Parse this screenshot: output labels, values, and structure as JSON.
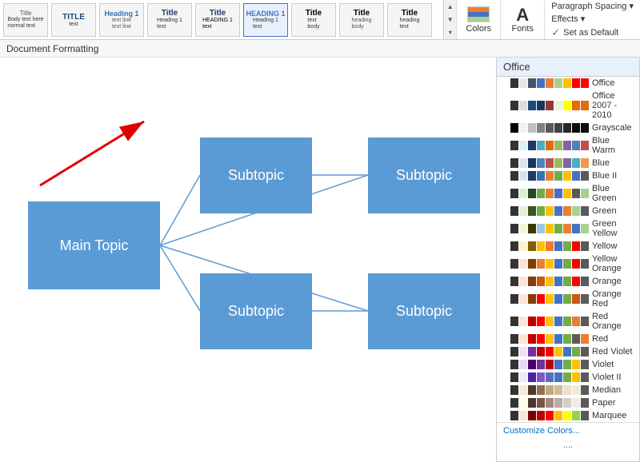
{
  "ribbon": {
    "styles": [
      {
        "label": "Normal",
        "lines": [
          "body",
          "body"
        ]
      },
      {
        "label": "TITLE",
        "lines": [
          "title"
        ]
      },
      {
        "label": "Text",
        "lines": [
          "text"
        ]
      },
      {
        "label": "Title",
        "lines": [
          "Title"
        ]
      },
      {
        "label": "Title",
        "lines": [
          "Title"
        ]
      },
      {
        "label": "HEADING 1",
        "lines": [
          "Heading 1"
        ]
      },
      {
        "label": "Title",
        "lines": [
          "Title"
        ]
      },
      {
        "label": "Title",
        "lines": [
          "Title"
        ]
      },
      {
        "label": "Title",
        "lines": [
          "Title"
        ]
      }
    ],
    "colors_label": "Colors",
    "fonts_label": "Fonts",
    "paragraph_spacing_label": "Paragraph Spacing ▾",
    "effects_label": "Effects ▾",
    "set_as_default_label": "Set as Default"
  },
  "doc_format_bar": {
    "label": "Document Formatting"
  },
  "mindmap": {
    "main_topic": "Main Topic",
    "subtopic1": "Subtopic",
    "subtopic2": "Subtopic",
    "subtopic3": "Subtopic",
    "subtopic4": "Subtopic"
  },
  "dropdown": {
    "header": "Office",
    "items": [
      {
        "label": "Office",
        "swatches": [
          "#fff",
          "#333",
          "#e7e6e6",
          "#44546a",
          "#4472c4",
          "#ed7d31",
          "#a9d18e",
          "#ffc000",
          "#ff0000",
          "#ff0000"
        ]
      },
      {
        "label": "Office 2007 - 2010",
        "swatches": [
          "#fff",
          "#333",
          "#ddd",
          "#1f497d",
          "#17375e",
          "#953734",
          "#ebf1dd",
          "#ffff00",
          "#e26b0a",
          "#e26b0a"
        ]
      },
      {
        "label": "Grayscale",
        "swatches": [
          "#fff",
          "#000",
          "#f2f2f2",
          "#bfbfbf",
          "#808080",
          "#595959",
          "#404040",
          "#262626",
          "#0d0d0d",
          "#0d0d0d"
        ]
      },
      {
        "label": "Blue Warm",
        "swatches": [
          "#fff",
          "#333",
          "#daeef3",
          "#1f3864",
          "#4bacc6",
          "#e36c09",
          "#9bbb59",
          "#8064a2",
          "#4f81bd",
          "#c0504d"
        ]
      },
      {
        "label": "Blue",
        "swatches": [
          "#fff",
          "#333",
          "#dce6f1",
          "#17375e",
          "#4f81bd",
          "#c0504d",
          "#9bbb59",
          "#8064a2",
          "#4bacc6",
          "#f79646"
        ]
      },
      {
        "label": "Blue II",
        "swatches": [
          "#fff",
          "#333",
          "#d9e2f3",
          "#1f3864",
          "#2f75b6",
          "#ed7d31",
          "#70ad47",
          "#ffc000",
          "#4472c4",
          "#5a5a5a"
        ]
      },
      {
        "label": "Blue Green",
        "swatches": [
          "#fff",
          "#333",
          "#d9f0d3",
          "#244a25",
          "#70ad47",
          "#ed7d31",
          "#4472c4",
          "#ffc000",
          "#5a5a5a",
          "#a9d18e"
        ]
      },
      {
        "label": "Green",
        "swatches": [
          "#fff",
          "#333",
          "#e2efda",
          "#375623",
          "#70ad47",
          "#ffc000",
          "#4472c4",
          "#ed7d31",
          "#a9d18e",
          "#5a5a5a"
        ]
      },
      {
        "label": "Green Yellow",
        "swatches": [
          "#fff",
          "#333",
          "#f2f7da",
          "#3a3a00",
          "#9dc3e6",
          "#ffc000",
          "#70ad47",
          "#ed7d31",
          "#4472c4",
          "#a9d18e"
        ]
      },
      {
        "label": "Yellow",
        "swatches": [
          "#fff",
          "#333",
          "#fff2cc",
          "#7f6000",
          "#ffc000",
          "#ed7d31",
          "#4472c4",
          "#70ad47",
          "#ff0000",
          "#5a5a5a"
        ]
      },
      {
        "label": "Yellow Orange",
        "swatches": [
          "#fff",
          "#333",
          "#fce4d6",
          "#833c00",
          "#ed7d31",
          "#ffc000",
          "#4472c4",
          "#70ad47",
          "#ff0000",
          "#5a5a5a"
        ]
      },
      {
        "label": "Orange",
        "swatches": [
          "#fff",
          "#333",
          "#fce4d6",
          "#843c0c",
          "#c55a11",
          "#ffc000",
          "#4472c4",
          "#70ad47",
          "#ff0000",
          "#5a5a5a"
        ]
      },
      {
        "label": "Orange Red",
        "swatches": [
          "#fff",
          "#333",
          "#fce4d6",
          "#843c0c",
          "#ff0000",
          "#ffc000",
          "#4472c4",
          "#70ad47",
          "#c55a11",
          "#5a5a5a"
        ]
      },
      {
        "label": "Red Orange",
        "swatches": [
          "#fff",
          "#333",
          "#fce4d6",
          "#c00000",
          "#ff0000",
          "#ffc000",
          "#4472c4",
          "#70ad47",
          "#ed7d31",
          "#5a5a5a"
        ]
      },
      {
        "label": "Red",
        "swatches": [
          "#fff",
          "#333",
          "#fce4d6",
          "#c00000",
          "#ff0000",
          "#ffc000",
          "#4472c4",
          "#70ad47",
          "#5a5a5a",
          "#ed7d31"
        ]
      },
      {
        "label": "Red Violet",
        "swatches": [
          "#fff",
          "#333",
          "#f4dcfa",
          "#7030a0",
          "#c00000",
          "#ff0000",
          "#ffc000",
          "#4472c4",
          "#70ad47",
          "#5a5a5a"
        ]
      },
      {
        "label": "Violet",
        "swatches": [
          "#fff",
          "#333",
          "#e8d5fa",
          "#49006a",
          "#7030a0",
          "#c00000",
          "#4472c4",
          "#70ad47",
          "#ffc000",
          "#5a5a5a"
        ]
      },
      {
        "label": "Violet II",
        "swatches": [
          "#fff",
          "#333",
          "#ede7f6",
          "#4527a0",
          "#7e57c2",
          "#5c6bc0",
          "#4472c4",
          "#70ad47",
          "#ffc000",
          "#5a5a5a"
        ]
      },
      {
        "label": "Median",
        "swatches": [
          "#fff",
          "#333",
          "#f3ead8",
          "#4b3b2a",
          "#94714a",
          "#c0a97c",
          "#d4ba96",
          "#ebe0cc",
          "#f3ead8",
          "#5a5a5a"
        ]
      },
      {
        "label": "Paper",
        "swatches": [
          "#fff",
          "#333",
          "#fffde7",
          "#4e342e",
          "#795548",
          "#a1887f",
          "#bcaaa4",
          "#d7ccc8",
          "#efebe9",
          "#5a5a5a"
        ]
      },
      {
        "label": "Marquee",
        "swatches": [
          "#fff",
          "#333",
          "#fce4d6",
          "#7f0000",
          "#c00000",
          "#ff0000",
          "#ffc000",
          "#ffff00",
          "#92d050",
          "#5a5a5a"
        ]
      }
    ],
    "customize_colors": "Customize Colors...",
    "more": "...."
  }
}
